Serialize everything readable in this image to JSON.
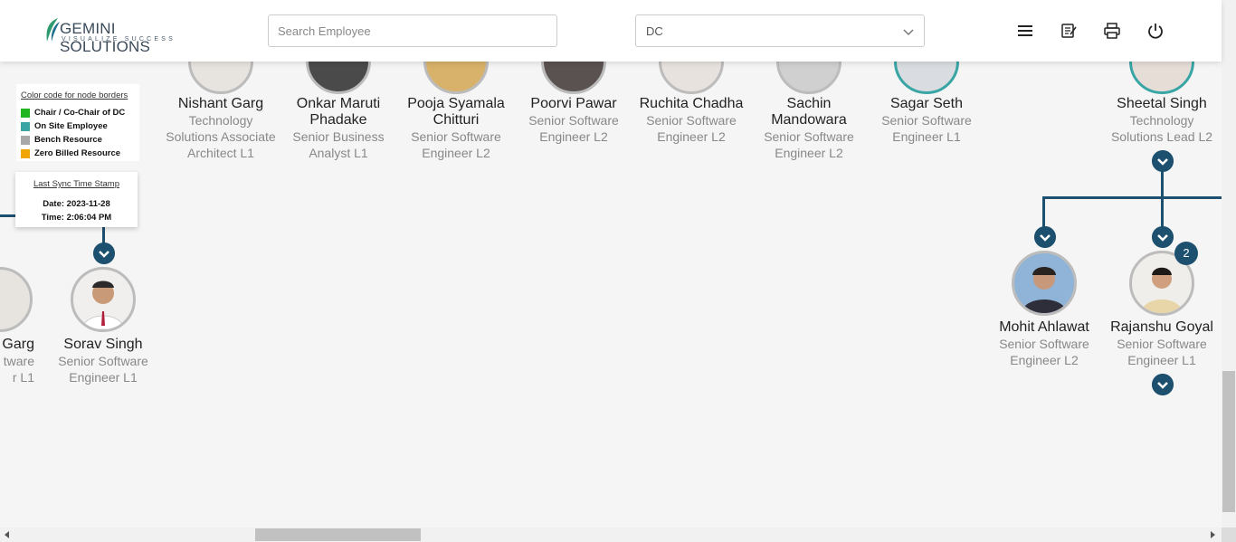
{
  "header": {
    "logo_main": "GEMINI SOLUTIONS",
    "logo_tagline": "VISUALIZE SUCCESS",
    "search_placeholder": "Search Employee",
    "dropdown_value": "DC",
    "icons": [
      "menu-icon",
      "notes-icon",
      "printer-icon",
      "power-icon"
    ]
  },
  "top_row": [
    {
      "name": "Nishant Garg",
      "role": "Technology Solutions Associate Architect L1"
    },
    {
      "name": "Onkar Maruti Phadake",
      "role": "Senior Business Analyst L1"
    },
    {
      "name": "Pooja Syamala Chitturi",
      "role": "Senior Software Engineer L2"
    },
    {
      "name": "Poorvi Pawar",
      "role": "Senior Software Engineer L2"
    },
    {
      "name": "Ruchita Chadha",
      "role": "Senior Software Engineer L2"
    },
    {
      "name": "Sachin Mandowara",
      "role": "Senior Software Engineer L2"
    },
    {
      "name": "Sagar Seth",
      "role": "Senior Software Engineer L1"
    },
    {
      "name": "Sheetal Singh",
      "role": "Technology Solutions Lead L2"
    }
  ],
  "left_nodes": [
    {
      "name": "Garg",
      "role_line1": "tware",
      "role_line2": "r L1"
    },
    {
      "name": "Sorav Singh",
      "role": "Senior Software Engineer L1"
    }
  ],
  "right_nodes": [
    {
      "name": "Mohit Ahlawat",
      "role": "Senior Software Engineer L2"
    },
    {
      "name": "Rajanshu Goyal",
      "role": "Senior Software Engineer L1",
      "badge": "2"
    }
  ],
  "legend": {
    "title": "Color code for node borders",
    "items": [
      {
        "label": "Chair / Co-Chair of DC",
        "color": "#22b522"
      },
      {
        "label": "On Site Employee",
        "color": "#3aa5a5"
      },
      {
        "label": "Bench Resource",
        "color": "#a8a8a8"
      },
      {
        "label": "Zero Billed Resource",
        "color": "#f0a500"
      }
    ]
  },
  "sync": {
    "title": "Last Sync Time Stamp",
    "date": "Date: 2023-11-28",
    "time": "Time: 2:06:04 PM"
  },
  "colors": {
    "accent": "#1d4f6e",
    "onsite_border": "#3aa5a5",
    "bench_border": "#bcbcbc"
  }
}
